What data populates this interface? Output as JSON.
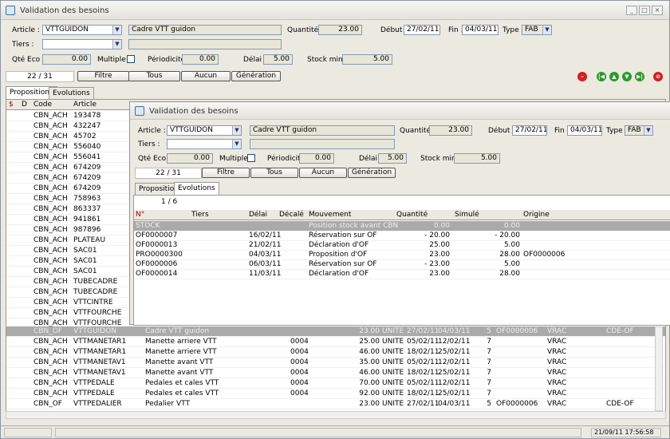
{
  "window": {
    "title": "Validation des besoins"
  },
  "form": {
    "article_label": "Article :",
    "article_value": "VTTGUIDON",
    "article_desc": "Cadre VTT guidon",
    "quantite_label": "Quantité :",
    "quantite_value": "23.00",
    "debut_label": "Début :",
    "debut_value": "27/02/11",
    "fin_label": "Fin :",
    "fin_value": "04/03/11",
    "type_label": "Type :",
    "type_value": "FAB",
    "tiers_label": "Tiers :",
    "qte_eco_label": "Qté Eco :",
    "qte_eco_value": "0.00",
    "multiple_label": "Multiple :",
    "periodicite_label": "Périodicité :",
    "periodicite_value": "0.00",
    "delai_label": "Délai :",
    "delai_value": "5.00",
    "stock_mini_label": "Stock mini :",
    "stock_mini_value": "5.00"
  },
  "toolbar": {
    "counter": "22 / 31",
    "filtre": "Filtre",
    "tous": "Tous",
    "aucun": "Aucun",
    "generation": "Génération"
  },
  "tabs": {
    "propositions": "Propositions",
    "evolutions": "Evolutions"
  },
  "main_grid": {
    "headers": [
      "$",
      "D",
      "Code",
      "Article"
    ],
    "left_rows": [
      [
        "CBN_ACH",
        "193478"
      ],
      [
        "CBN_ACH",
        "432247"
      ],
      [
        "CBN_ACH",
        "45702"
      ],
      [
        "CBN_ACH",
        "556040"
      ],
      [
        "CBN_ACH",
        "556041"
      ],
      [
        "CBN_ACH",
        "674209"
      ],
      [
        "CBN_ACH",
        "674209"
      ],
      [
        "CBN_ACH",
        "674209"
      ],
      [
        "CBN_ACH",
        "758963"
      ],
      [
        "CBN_ACH",
        "863337"
      ],
      [
        "CBN_ACH",
        "941861"
      ],
      [
        "CBN_ACH",
        "987896"
      ],
      [
        "CBN_ACH",
        "PLATEAU"
      ],
      [
        "CBN_ACH",
        "SAC01"
      ],
      [
        "CBN_ACH",
        "SAC01"
      ],
      [
        "CBN_ACH",
        "SAC01"
      ],
      [
        "CBN_ACH",
        "TUBECADRE"
      ],
      [
        "CBN_ACH",
        "TUBECADRE"
      ],
      [
        "CBN_ACH",
        "VTTCINTRE"
      ],
      [
        "CBN_ACH",
        "VTTFOURCHE"
      ],
      [
        "CBN_ACH",
        "VTTFOURCHE"
      ]
    ],
    "bottom_rows": [
      [
        "CBN_OF",
        "VTTGUIDON",
        "Cadre VTT guidon",
        "",
        "23.00",
        "UNITE",
        "27/02/11",
        "04/03/11",
        "5",
        "OF0000006",
        "VRAC",
        "CDE-OF"
      ],
      [
        "CBN_ACH",
        "VTTMANETAR1",
        "Manette arriere VTT",
        "0004",
        "25.00",
        "UNITE",
        "05/02/11",
        "12/02/11",
        "7",
        "",
        "VRAC",
        ""
      ],
      [
        "CBN_ACH",
        "VTTMANETAR1",
        "Manette arriere VTT",
        "0004",
        "46.00",
        "UNITE",
        "18/02/11",
        "25/02/11",
        "7",
        "",
        "VRAC",
        ""
      ],
      [
        "CBN_ACH",
        "VTTMANETAV1",
        "Manette avant VTT",
        "0004",
        "35.00",
        "UNITE",
        "05/02/11",
        "12/02/11",
        "7",
        "",
        "VRAC",
        ""
      ],
      [
        "CBN_ACH",
        "VTTMANETAV1",
        "Manette avant VTT",
        "0004",
        "46.00",
        "UNITE",
        "18/02/11",
        "25/02/11",
        "7",
        "",
        "VRAC",
        ""
      ],
      [
        "CBN_ACH",
        "VTTPEDALE",
        "Pedales et cales VTT",
        "0004",
        "70.00",
        "UNITE",
        "05/02/11",
        "12/02/11",
        "7",
        "",
        "VRAC",
        ""
      ],
      [
        "CBN_ACH",
        "VTTPEDALE",
        "Pedales et cales VTT",
        "0004",
        "92.00",
        "UNITE",
        "18/02/11",
        "25/02/11",
        "7",
        "",
        "VRAC",
        ""
      ],
      [
        "CBN_OF",
        "VTTPEDALIER",
        "Pedalier VTT",
        "",
        "23.00",
        "UNITE",
        "27/02/11",
        "04/03/11",
        "5",
        "OF0000006",
        "VRAC",
        "CDE-OF"
      ]
    ]
  },
  "inner_window": {
    "title": "Validation des besoins",
    "subcounter": "1 / 6",
    "headers": [
      "N°",
      "Tiers",
      "Délai",
      "Décalé",
      "Mouvement",
      "Quantité",
      "Simulé",
      "Origine"
    ],
    "rows": [
      [
        "STOCK",
        "",
        "",
        "",
        "Position stock avant CBN",
        "0.00",
        "0.00",
        ""
      ],
      [
        "OF0000007",
        "",
        "16/02/11",
        "",
        "Réservation sur OF",
        "- 20.00",
        "- 20.00",
        ""
      ],
      [
        "OF0000013",
        "",
        "21/02/11",
        "",
        "Déclaration d'OF",
        "25.00",
        "5.00",
        ""
      ],
      [
        "PRO0000300",
        "",
        "04/03/11",
        "",
        "Proposition d'OF",
        "23.00",
        "28.00",
        "OF0000006"
      ],
      [
        "OF0000006",
        "",
        "06/03/11",
        "",
        "Réservation sur OF",
        "- 23.00",
        "5.00",
        ""
      ],
      [
        "OF0000014",
        "",
        "11/03/11",
        "",
        "Déclaration d'OF",
        "23.00",
        "28.00",
        ""
      ]
    ]
  },
  "status": {
    "datetime": "21/09/11  17:56:58"
  },
  "colors": {
    "selected_row": "#aaaaaa",
    "red_icon": "#d42020",
    "green_icon": "#2a9a2a"
  }
}
